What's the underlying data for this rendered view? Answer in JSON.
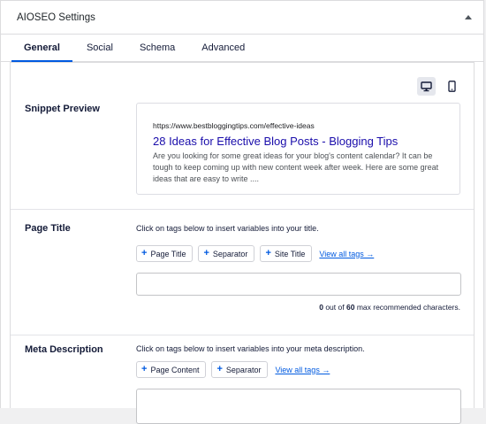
{
  "panel": {
    "title": "AIOSEO Settings"
  },
  "tabs": [
    {
      "label": "General",
      "active": true
    },
    {
      "label": "Social"
    },
    {
      "label": "Schema"
    },
    {
      "label": "Advanced"
    }
  ],
  "devices": {
    "desktop_icon": "desktop-icon",
    "mobile_icon": "mobile-icon"
  },
  "snippet_preview": {
    "label": "Snippet Preview",
    "url": "https://www.bestbloggingtips.com/effective-ideas",
    "title": "28 Ideas for Effective Blog Posts - Blogging Tips",
    "description": "Are you looking for some great ideas for your blog's content calendar? It can be tough to keep coming up with new content week after week. Here are some great ideas that are easy to write ...."
  },
  "page_title": {
    "label": "Page Title",
    "hint": "Click on tags below to insert variables into your title.",
    "tags": [
      "Page Title",
      "Separator",
      "Site Title"
    ],
    "view_all": "View all tags →",
    "value": "",
    "count": "0",
    "out_of": "out of",
    "max": "60",
    "suffix": "max recommended characters."
  },
  "meta_description": {
    "label": "Meta Description",
    "hint": "Click on tags below to insert variables into your meta description.",
    "tags": [
      "Page Content",
      "Separator"
    ],
    "view_all": "View all tags →",
    "value": ""
  },
  "colors": {
    "accent": "#005ae0",
    "link": "#1a0dab",
    "text": "#141b38"
  }
}
